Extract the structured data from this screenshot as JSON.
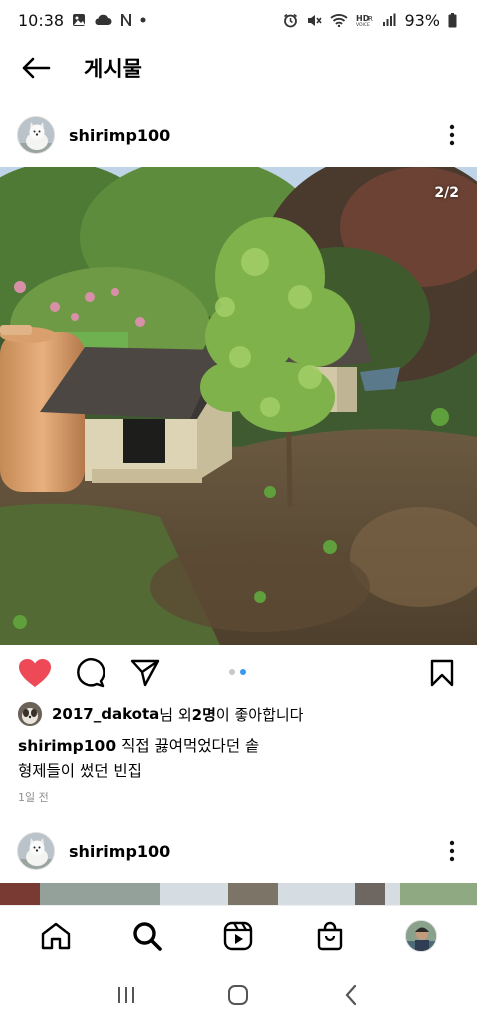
{
  "status_bar": {
    "time": "10:38",
    "left_icons": [
      "gallery-icon",
      "cloud-icon",
      "n-icon",
      "dot-icon"
    ],
    "right_icons": [
      "alarm-icon",
      "mute-icon",
      "wifi-icon",
      "hd-volte-icon",
      "signal-icon",
      "battery-icon"
    ],
    "battery": "93%"
  },
  "header": {
    "title": "게시물",
    "back_icon": "arrow-left-icon"
  },
  "post": {
    "username": "shirimp100",
    "image_counter": "2/2",
    "carousel": {
      "total": 2,
      "active_index": 1
    },
    "liked": true,
    "likes": {
      "user": "2017_dakota",
      "suffix_1": "님 외 ",
      "count_text": "2명",
      "suffix_2": "이 좋아합니다"
    },
    "caption": {
      "username": "shirimp100",
      "line_1": " 직접 끓여먹었다던 솥",
      "line_2": "형제들이 썼던 빈집"
    },
    "time_ago": "1일 전"
  },
  "next_post": {
    "username": "shirimp100"
  },
  "bottom_nav": {
    "items": [
      "home-icon",
      "search-icon",
      "reels-icon",
      "shop-icon",
      "profile-avatar"
    ]
  },
  "colors": {
    "like_red": "#ed4956",
    "dot_active": "#3897f0",
    "dot_inactive": "#c8c8c8",
    "muted_text": "#8e8e8e"
  }
}
